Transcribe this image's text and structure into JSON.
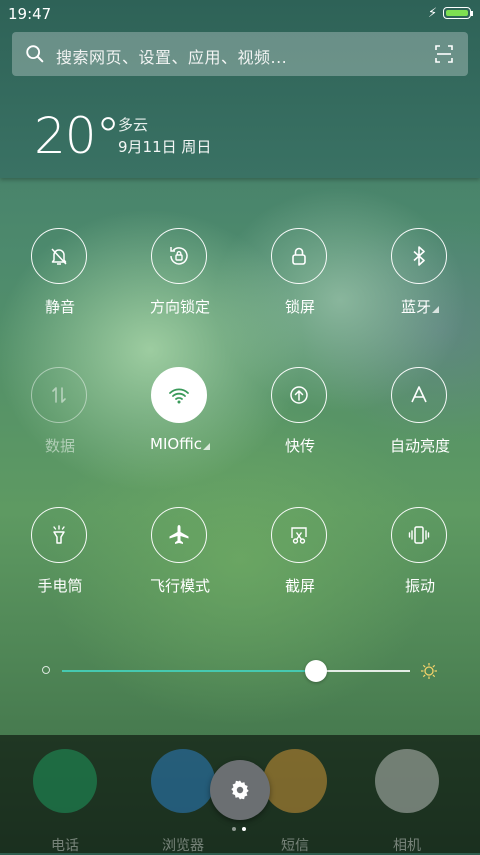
{
  "status_bar": {
    "time": "19:47",
    "battery_color": "#7ee052"
  },
  "search": {
    "placeholder": "搜索网页、设置、应用、视频..."
  },
  "weather": {
    "temperature": "20°",
    "condition": "多云",
    "date": "9月11日 周日"
  },
  "toggles": [
    {
      "label": "静音",
      "icon": "bell-off-icon",
      "state": "off"
    },
    {
      "label": "方向锁定",
      "icon": "rotation-lock-icon",
      "state": "off"
    },
    {
      "label": "锁屏",
      "icon": "lock-icon",
      "state": "off"
    },
    {
      "label": "蓝牙",
      "icon": "bluetooth-icon",
      "state": "off",
      "has_more": true
    },
    {
      "label": "数据",
      "icon": "mobile-data-icon",
      "state": "disabled"
    },
    {
      "label": "MIOffic",
      "icon": "wifi-icon",
      "state": "on",
      "has_more": true
    },
    {
      "label": "快传",
      "icon": "fast-transfer-icon",
      "state": "off"
    },
    {
      "label": "自动亮度",
      "icon": "auto-brightness-icon",
      "state": "off"
    },
    {
      "label": "手电筒",
      "icon": "flashlight-icon",
      "state": "off"
    },
    {
      "label": "飞行模式",
      "icon": "airplane-icon",
      "state": "off"
    },
    {
      "label": "截屏",
      "icon": "screenshot-icon",
      "state": "off"
    },
    {
      "label": "振动",
      "icon": "vibrate-icon",
      "state": "off"
    }
  ],
  "brightness": {
    "level_percent": 73,
    "accent_color": "#46c9b0"
  },
  "dock": {
    "apps": [
      {
        "label": "电话",
        "icon": "phone-icon",
        "color": "#1fae6a"
      },
      {
        "label": "浏览器",
        "icon": "browser-icon",
        "color": "#2f8de4"
      },
      {
        "label": "短信",
        "icon": "messages-icon",
        "color": "#f2a93b"
      },
      {
        "label": "相机",
        "icon": "camera-icon",
        "color": "#d9d9d9"
      }
    ]
  },
  "pager": {
    "pages": 2,
    "current": 2
  }
}
